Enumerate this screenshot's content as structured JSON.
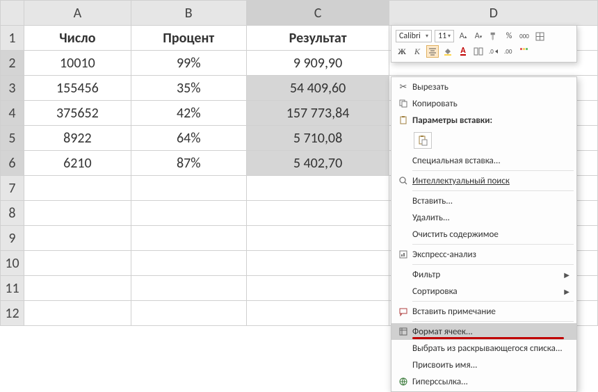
{
  "columns": [
    "A",
    "B",
    "C",
    "D"
  ],
  "row_numbers": [
    1,
    2,
    3,
    4,
    5,
    6,
    7,
    8,
    9,
    10,
    11,
    12
  ],
  "headers": {
    "A": "Число",
    "B": "Процент",
    "C": "Результат"
  },
  "rows": [
    {
      "A": "10010",
      "B": "99%",
      "C": "9 909,90"
    },
    {
      "A": "155456",
      "B": "35%",
      "C": "54 409,60"
    },
    {
      "A": "375652",
      "B": "42%",
      "C": "157 773,84"
    },
    {
      "A": "8922",
      "B": "64%",
      "C": "5 710,08"
    },
    {
      "A": "6210",
      "B": "87%",
      "C": "5 402,70"
    }
  ],
  "mini_toolbar": {
    "font_name": "Calibri",
    "font_size": "11",
    "bold_label": "Ж",
    "italic_label": "К",
    "percent_label": "%",
    "thousands_label": "000"
  },
  "context_menu": {
    "cut": "Вырезать",
    "copy": "Копировать",
    "paste_options": "Параметры вставки:",
    "paste_special": "Специальная вставка...",
    "smart_lookup": "Интеллектуальный поиск",
    "insert": "Вставить...",
    "delete": "Удалить...",
    "clear": "Очистить содержимое",
    "quick_analysis": "Экспресс-анализ",
    "filter": "Фильтр",
    "sort": "Сортировка",
    "insert_comment": "Вставить примечание",
    "format_cells": "Формат ячеек...",
    "pick_from_list": "Выбрать из раскрывающегося списка...",
    "define_name": "Присвоить имя...",
    "hyperlink": "Гиперссылка..."
  }
}
